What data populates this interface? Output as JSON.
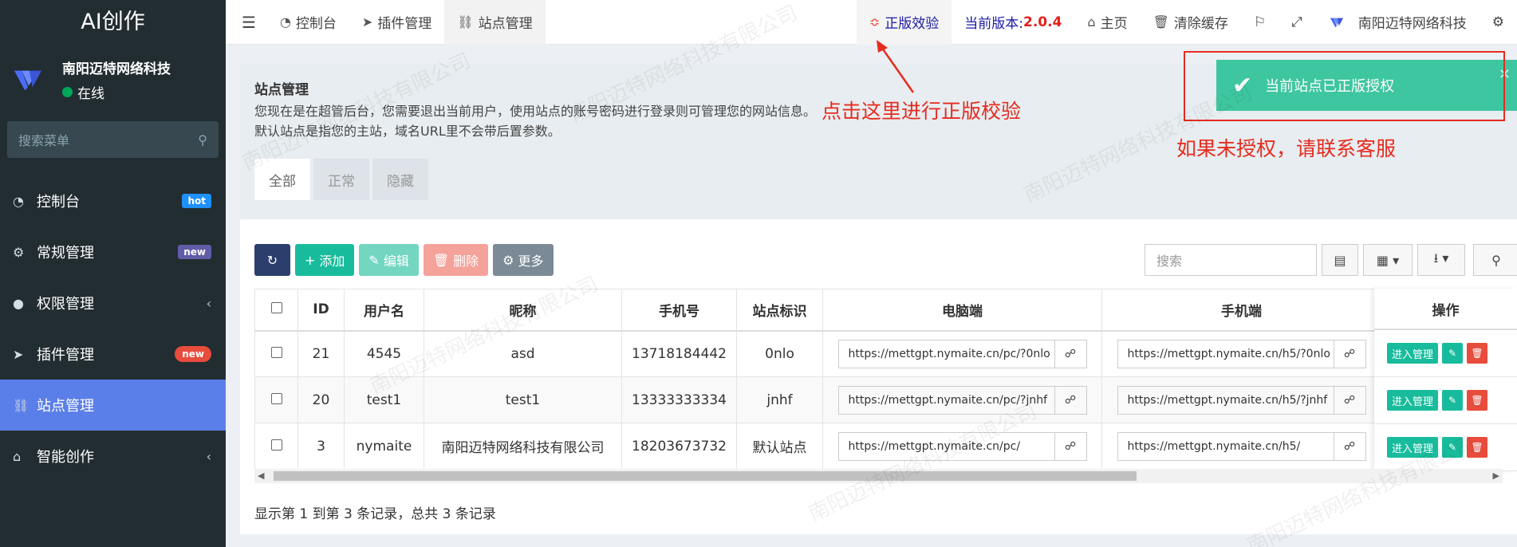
{
  "sidebar": {
    "brand": "AI创作",
    "user_name": "南阳迈特网络科技",
    "user_status": "在线",
    "search_placeholder": "搜索菜单",
    "items": [
      {
        "label": "控制台",
        "icon": "dashboard-icon",
        "badge": "hot"
      },
      {
        "label": "常规管理",
        "icon": "cogs-icon",
        "badge": "new"
      },
      {
        "label": "权限管理",
        "icon": "users-icon",
        "badge": ""
      },
      {
        "label": "插件管理",
        "icon": "rocket-icon",
        "badge": "new"
      },
      {
        "label": "站点管理",
        "icon": "bank-icon",
        "badge": ""
      },
      {
        "label": "智能创作",
        "icon": "home-icon",
        "badge": ""
      }
    ]
  },
  "topnav": {
    "tabs": [
      {
        "label": "控制台",
        "icon": "dashboard-icon"
      },
      {
        "label": "插件管理",
        "icon": "rocket-icon"
      },
      {
        "label": "站点管理",
        "icon": "bank-icon"
      }
    ],
    "verify_label": "正版效验",
    "version_label": "当前版本:",
    "version_value": "2.0.4",
    "home_label": "主页",
    "clear_cache_label": "清除缓存",
    "company_label": "南阳迈特网络科技"
  },
  "panel": {
    "title": "站点管理",
    "desc_line1": "您现在是在超管后台，您需要退出当前用户，使用站点的账号密码进行登录则可管理您的网站信息。",
    "desc_line2": "默认站点是指您的主站，域名URL里不会带后置参数。",
    "tabs": [
      "全部",
      "正常",
      "隐藏"
    ]
  },
  "toolbar": {
    "add": "添加",
    "edit": "编辑",
    "delete": "删除",
    "more": "更多",
    "search_placeholder": "搜索"
  },
  "table": {
    "headers": [
      "ID",
      "用户名",
      "昵称",
      "手机号",
      "站点标识",
      "电脑端",
      "手机端",
      "操作"
    ],
    "rows": [
      {
        "id": "21",
        "username": "4545",
        "nickname": "asd",
        "phone": "13718184442",
        "site_id": "0nlo",
        "pc": "https://mettgpt.nymaite.cn/pc/?0nlo",
        "h5": "https://mettgpt.nymaite.cn/h5/?0nlo"
      },
      {
        "id": "20",
        "username": "test1",
        "nickname": "test1",
        "phone": "13333333334",
        "site_id": "jnhf",
        "pc": "https://mettgpt.nymaite.cn/pc/?jnhf",
        "h5": "https://mettgpt.nymaite.cn/h5/?jnhf"
      },
      {
        "id": "3",
        "username": "nymaite",
        "nickname": "南阳迈特网络科技有限公司",
        "phone": "18203673732",
        "site_id": "默认站点",
        "pc": "https://mettgpt.nymaite.cn/pc/",
        "h5": "https://mettgpt.nymaite.cn/h5/"
      }
    ],
    "op_enter": "进入管理",
    "footer": "显示第 1 到第 3 条记录，总共 3 条记录"
  },
  "notice": {
    "toast": "当前站点已正版授权",
    "annotation_click": "点击这里进行正版校验",
    "annotation_contact": "如果未授权，请联系客服"
  },
  "watermark": "南阳迈特网络科技有限公司",
  "colors": {
    "sidebar_bg": "#222d32",
    "active_menu": "#5b7fe8",
    "success": "#18bc9c",
    "danger": "#e74c3c",
    "annotation": "#e52c1f"
  }
}
